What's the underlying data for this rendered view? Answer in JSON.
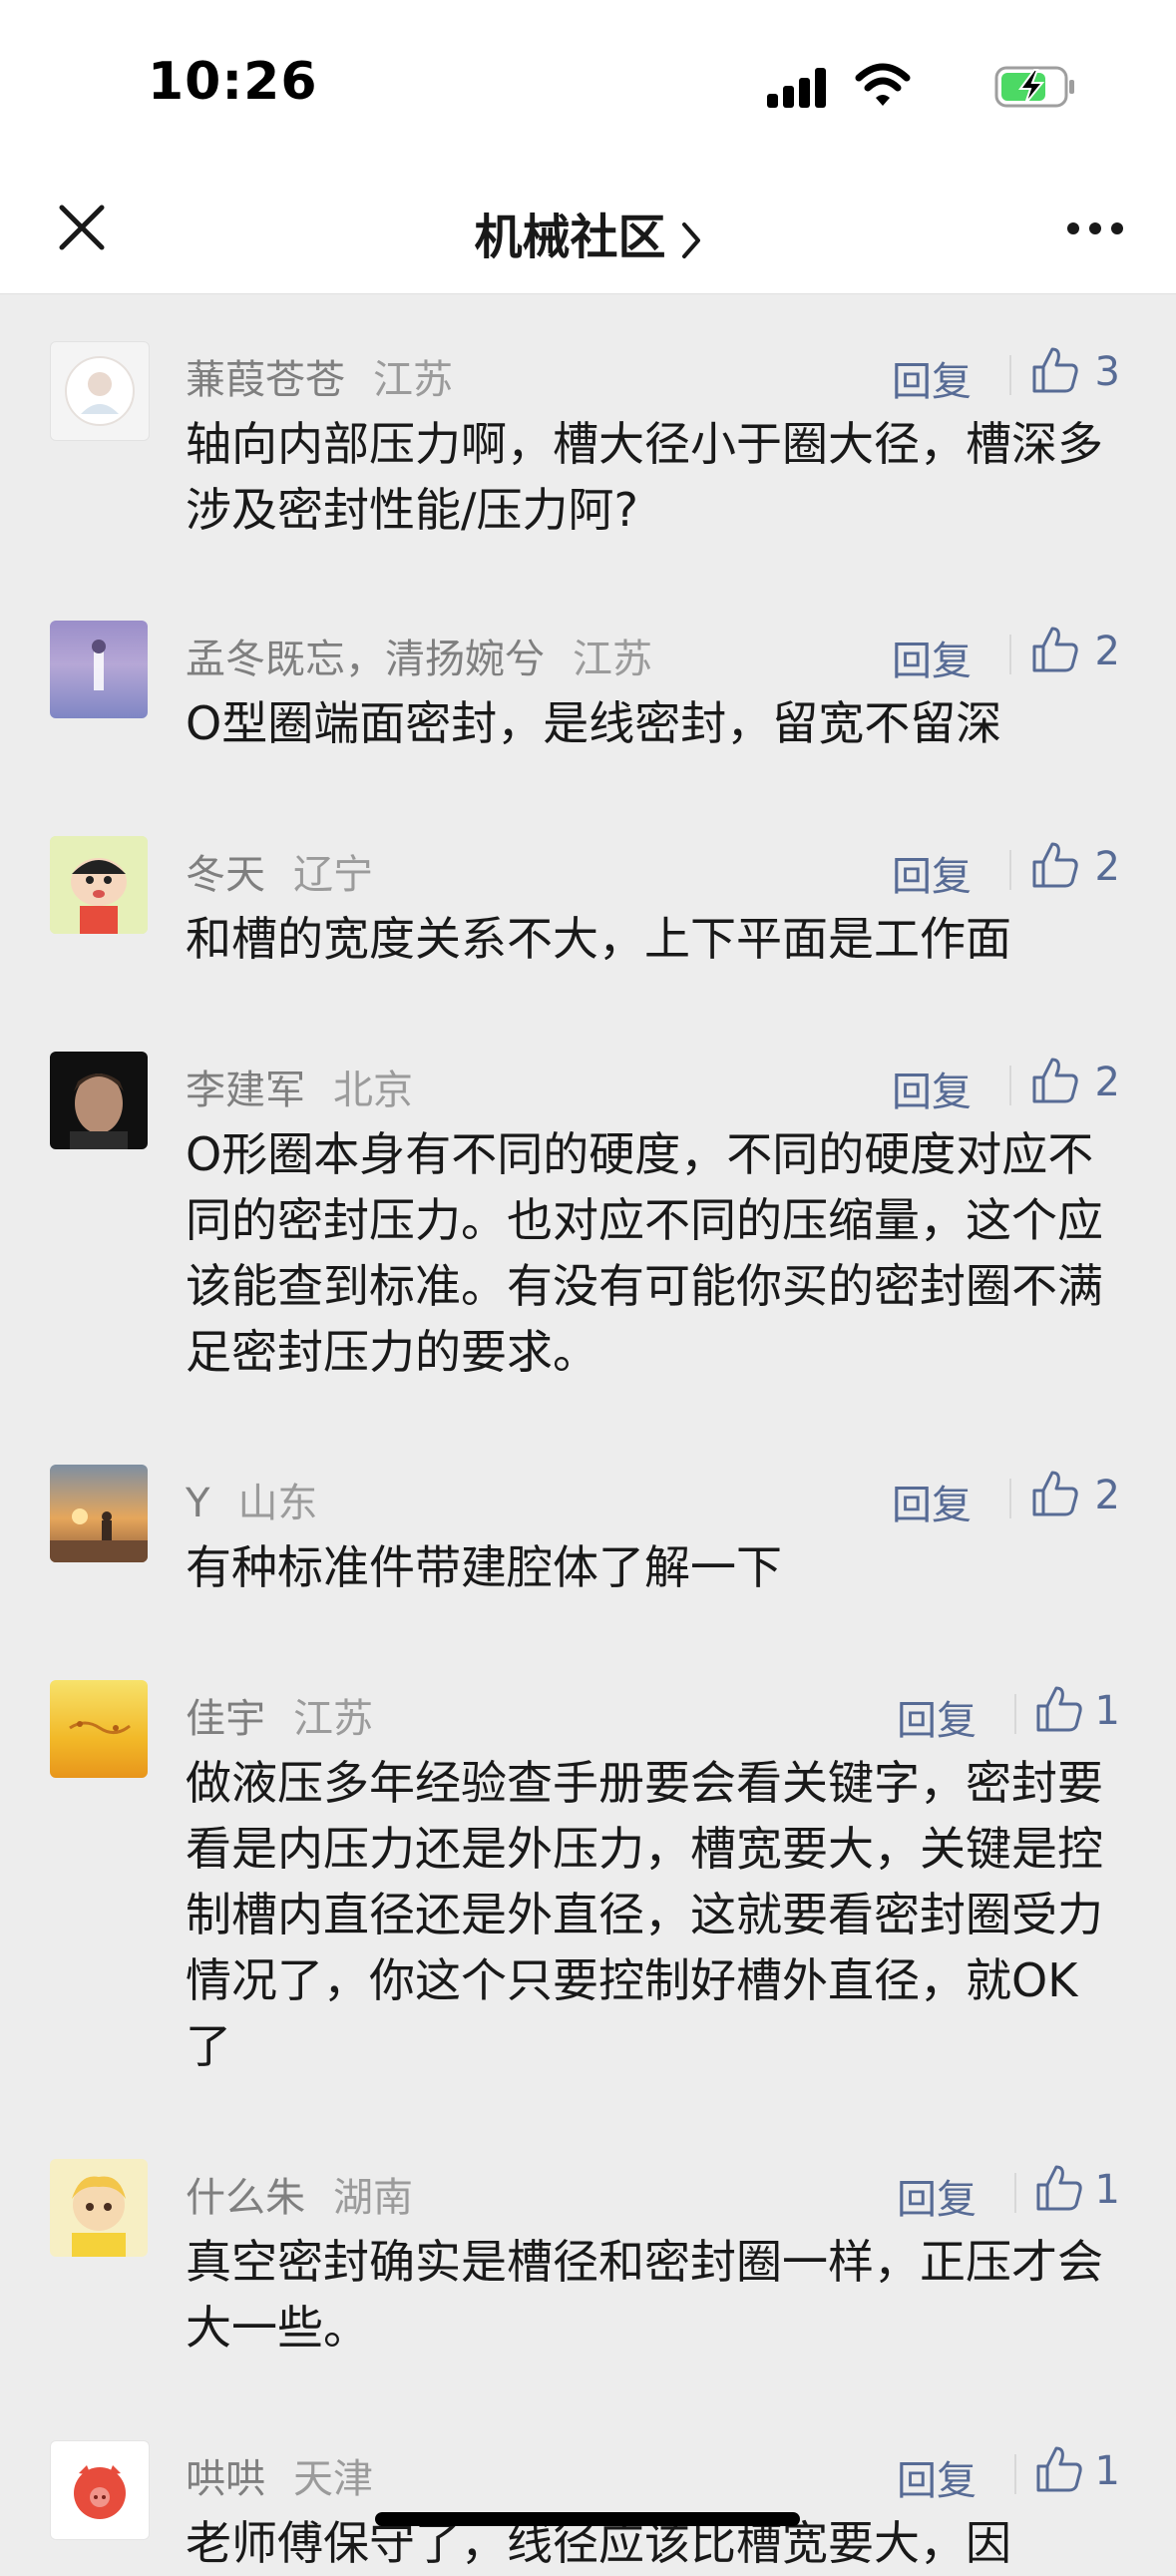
{
  "status_bar": {
    "time": "10:26"
  },
  "nav": {
    "title": "机械社区"
  },
  "reply_label": "回复",
  "comments": [
    {
      "name": "蒹葭苍苍",
      "location": "江苏",
      "likes": "3",
      "text": "轴向内部压力啊，槽大径小于圈大径，槽深多涉及密封性能/压力阿?"
    },
    {
      "name": "孟冬既忘，清扬婉兮",
      "location": "江苏",
      "likes": "2",
      "text": "O型圈端面密封，是线密封，留宽不留深"
    },
    {
      "name": "冬天",
      "location": "辽宁",
      "likes": "2",
      "text": "和槽的宽度关系不大，上下平面是工作面"
    },
    {
      "name": "李建军",
      "location": "北京",
      "likes": "2",
      "text": "O形圈本身有不同的硬度，不同的硬度对应不同的密封压力。也对应不同的压缩量，这个应该能查到标准。有没有可能你买的密封圈不满足密封压力的要求。"
    },
    {
      "name": "Y",
      "location": "山东",
      "likes": "2",
      "text": "有种标准件带建腔体了解一下"
    },
    {
      "name": "佳宇",
      "location": "江苏",
      "likes": "1",
      "text": "做液压多年经验查手册要会看关键字，密封要看是内压力还是外压力，槽宽要大，关键是控制槽内直径还是外直径，这就要看密封圈受力情况了，你这个只要控制好槽外直径，就OK了"
    },
    {
      "name": "什么朱",
      "location": "湖南",
      "likes": "1",
      "text": "真空密封确实是槽径和密封圈一样，正压才会大一些。"
    },
    {
      "name": "哄哄",
      "location": "天津",
      "likes": "1",
      "text": "老师傅保守了，线径应该比槽宽要大，因"
    }
  ]
}
